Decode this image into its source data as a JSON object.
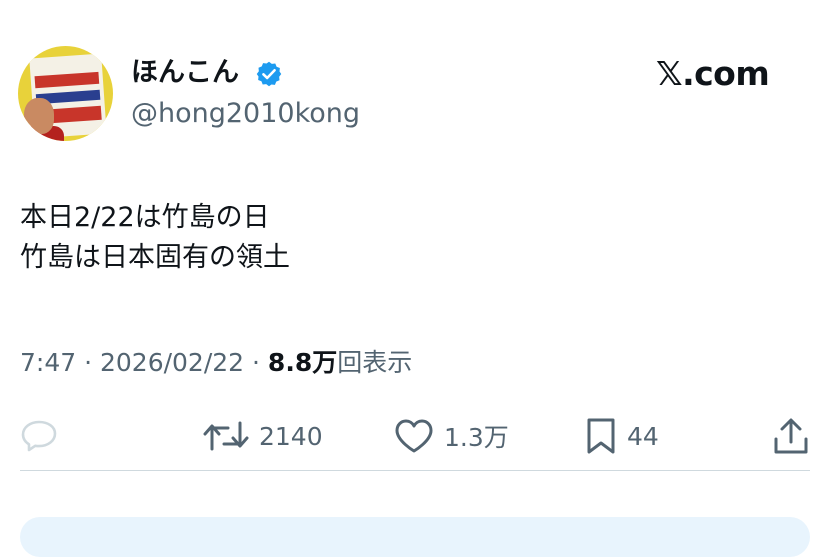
{
  "author": {
    "display_name": "ほんこん",
    "handle": "@hong2010kong",
    "verified": true,
    "avatar": "profile-photo-book-cover"
  },
  "brand": {
    "label": "𝕏.com"
  },
  "tweet": {
    "lines": [
      "本日2/22は竹島の日",
      "竹島は日本固有の領土"
    ]
  },
  "meta": {
    "time": "7:47",
    "separator": " · ",
    "date": "2026/02/22",
    "views_count": "8.8万",
    "views_label": "回表示"
  },
  "actions": {
    "reply": {
      "icon": "reply-bubble-icon",
      "count": ""
    },
    "retweet": {
      "icon": "retweet-icon",
      "count": "2140"
    },
    "like": {
      "icon": "heart-icon",
      "count": "1.3万"
    },
    "bookmark": {
      "icon": "bookmark-icon",
      "count": "44"
    },
    "share": {
      "icon": "share-upload-icon"
    }
  },
  "colors": {
    "text": "#0f1419",
    "secondary": "#536471",
    "verified": "#1d9bf0",
    "divider": "#cfd9de",
    "reply_box": "#e8f4fd"
  }
}
